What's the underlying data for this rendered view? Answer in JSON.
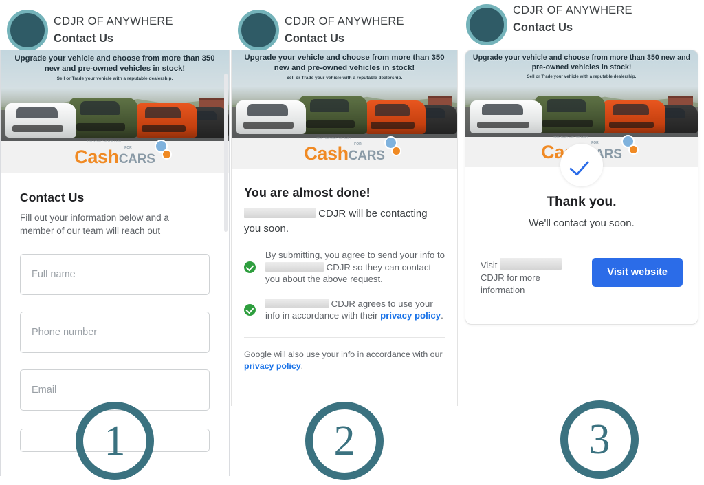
{
  "header": {
    "business_name": "CDJR OF ANYWHERE",
    "subtitle": "Contact Us",
    "avatar_icon": "avatar-circle-icon",
    "colors": {
      "avatar_fill": "#2f5b66",
      "avatar_ring": "#74b3ba"
    }
  },
  "banner": {
    "headline": "Upgrade your vehicle and choose from more than 350 new and pre-owned vehicles in stock!",
    "subline": "Sell or Trade your vehicle with a reputable dealership.",
    "logo": {
      "word1": "Cash",
      "word2": "CARS",
      "small": "FOR",
      "tiny": "SELL YOUR CAR FOR CASH"
    }
  },
  "panel1": {
    "form_title": "Contact Us",
    "form_description": "Fill out your information below and a member of our team will reach out",
    "fields": [
      {
        "name": "full-name",
        "placeholder": "Full name",
        "value": ""
      },
      {
        "name": "phone-number",
        "placeholder": "Phone number",
        "value": ""
      },
      {
        "name": "email",
        "placeholder": "Email",
        "value": ""
      }
    ],
    "step_number": "1"
  },
  "panel2": {
    "title": "You are almost done!",
    "lead_suffix": "CDJR will be contacting you soon.",
    "agreements": [
      {
        "icon": "green-check-icon",
        "before": "By submitting, you agree to send your info to",
        "after": "CDJR so they can contact you about the above request.",
        "link": "",
        "tail": ""
      },
      {
        "icon": "green-check-icon",
        "before": "",
        "after": "CDJR agrees to use your info in accordance with their",
        "link": "privacy policy",
        "tail": "."
      }
    ],
    "google_notice_before": "Google will also use your info in accordance with our",
    "google_notice_link": "privacy policy",
    "google_notice_tail": ".",
    "step_number": "2"
  },
  "panel3": {
    "check_icon": "blue-check-icon",
    "title": "Thank you.",
    "subtitle": "We'll contact you soon.",
    "visit_before": "Visit",
    "visit_after": "CDJR for more information",
    "button_label": "Visit website",
    "step_number": "3"
  },
  "colors": {
    "step_teal": "#3b7280",
    "link_blue": "#1a73e8",
    "button_blue": "#2b6ce8",
    "check_green": "#2e9e3e",
    "logo_orange": "#F08A24",
    "logo_gray": "#8a9aa6"
  }
}
